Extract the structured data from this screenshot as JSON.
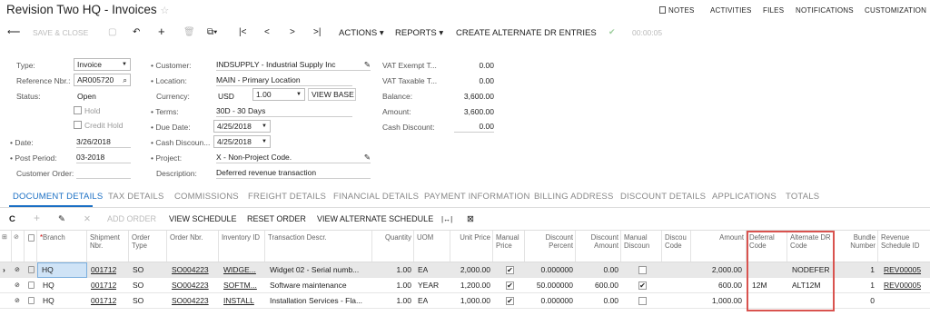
{
  "header": {
    "title": "Revision Two HQ",
    "sep": "-",
    "subtitle": "Invoices",
    "star": "☆"
  },
  "topnav": {
    "notes": "NOTES",
    "activities": "ACTIVITIES",
    "files": "FILES",
    "notifications": "NOTIFICATIONS",
    "customization": "CUSTOMIZATION"
  },
  "toolbar": {
    "back": "⟵",
    "save_close": "SAVE & CLOSE",
    "save": "▢",
    "undo": "↶",
    "add": "+",
    "delete": "🗑",
    "copy": "⧉▾",
    "first": "|<",
    "prev": "<",
    "next": ">",
    "last": ">|",
    "actions": "ACTIONS ▾",
    "reports": "REPORTS ▾",
    "create_alt": "CREATE ALTERNATE DR ENTRIES",
    "check": "✔",
    "timer": "00:00:05"
  },
  "form": {
    "type_label": "Type:",
    "type_value": "Invoice",
    "ref_label": "Reference Nbr.:",
    "ref_value": "AR005720",
    "status_label": "Status:",
    "status_value": "Open",
    "hold_label": "Hold",
    "credit_hold_label": "Credit Hold",
    "date_label": "Date:",
    "date_value": "3/26/2018",
    "post_period_label": "Post Period:",
    "post_period_value": "03-2018",
    "customer_order_label": "Customer Order:",
    "customer_label": "Customer:",
    "customer_value": "INDSUPPLY - Industrial Supply Inc",
    "location_label": "Location:",
    "location_value": "MAIN - Primary Location",
    "currency_label": "Currency:",
    "currency_value": "USD",
    "rate_value": "1.00",
    "view_base": "VIEW BASE",
    "terms_label": "Terms:",
    "terms_value": "30D - 30 Days",
    "due_date_label": "Due Date:",
    "due_date_value": "4/25/2018",
    "cash_disc_label": "Cash Discoun...",
    "cash_disc_value": "4/25/2018",
    "project_label": "Project:",
    "project_value": "X - Non-Project Code.",
    "description_label": "Description:",
    "description_value": "Deferred revenue transaction",
    "vat_exempt_label": "VAT Exempt T...",
    "vat_exempt_value": "0.00",
    "vat_taxable_label": "VAT Taxable T...",
    "vat_taxable_value": "0.00",
    "balance_label": "Balance:",
    "balance_value": "3,600.00",
    "amount_label": "Amount:",
    "amount_value": "3,600.00",
    "cash_discount_label": "Cash Discount:",
    "cash_discount_value": "0.00"
  },
  "tabs": [
    "DOCUMENT DETAILS",
    "TAX DETAILS",
    "COMMISSIONS",
    "FREIGHT DETAILS",
    "FINANCIAL DETAILS",
    "PAYMENT INFORMATION",
    "BILLING ADDRESS",
    "DISCOUNT DETAILS",
    "APPLICATIONS",
    "TOTALS"
  ],
  "grid_toolbar": {
    "refresh": "C",
    "add": "+",
    "edit": "✎",
    "remove": "✕",
    "add_order": "ADD ORDER",
    "view_schedule": "VIEW SCHEDULE",
    "reset_order": "RESET ORDER",
    "view_alt": "VIEW ALTERNATE SCHEDULE",
    "fit": "|↔|",
    "export": "⊠"
  },
  "columns": [
    "Branch",
    "Shipment Nbr.",
    "Order Type",
    "Order Nbr.",
    "Inventory ID",
    "Transaction Descr.",
    "Quantity",
    "UOM",
    "Unit Price",
    "Manual Price",
    "Discount Percent",
    "Discount Amount",
    "Manual Discoun",
    "Discou Code",
    "Amount",
    "Deferral Code",
    "Alternate DR Code",
    "Bundle Number",
    "Revenue Schedule ID"
  ],
  "rows": [
    {
      "branch": "HQ",
      "shipment": "001712",
      "order_type": "SO",
      "order_nbr": "SO004223",
      "inventory": "WIDGE...",
      "descr": "Widget 02 - Serial numb...",
      "qty": "1.00",
      "uom": "EA",
      "unit_price": "2,000.00",
      "manual_price": true,
      "disc_pct": "0.000000",
      "disc_amt": "0.00",
      "manual_disc": false,
      "disc_code": "",
      "amount": "2,000.00",
      "deferral": "",
      "alt_dr": "NODEFER",
      "bundle": "1",
      "schedule": "REV00005"
    },
    {
      "branch": "HQ",
      "shipment": "001712",
      "order_type": "SO",
      "order_nbr": "SO004223",
      "inventory": "SOFTM...",
      "descr": "Software maintenance",
      "qty": "1.00",
      "uom": "YEAR",
      "unit_price": "1,200.00",
      "manual_price": true,
      "disc_pct": "50.000000",
      "disc_amt": "600.00",
      "manual_disc": true,
      "disc_code": "",
      "amount": "600.00",
      "deferral": "12M",
      "alt_dr": "ALT12M",
      "bundle": "1",
      "schedule": "REV00005"
    },
    {
      "branch": "HQ",
      "shipment": "001712",
      "order_type": "SO",
      "order_nbr": "SO004223",
      "inventory": "INSTALL",
      "descr": "Installation Services - Fla...",
      "qty": "1.00",
      "uom": "EA",
      "unit_price": "1,000.00",
      "manual_price": true,
      "disc_pct": "0.000000",
      "disc_amt": "0.00",
      "manual_disc": false,
      "disc_code": "",
      "amount": "1,000.00",
      "deferral": "",
      "alt_dr": "",
      "bundle": "0",
      "schedule": ""
    }
  ]
}
